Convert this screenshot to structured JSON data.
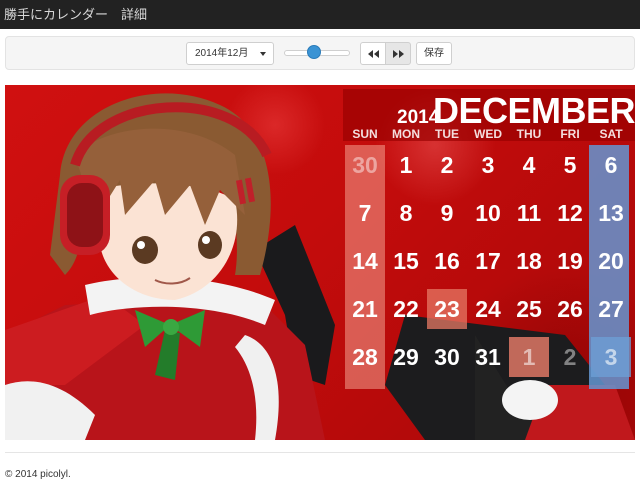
{
  "app": {
    "title": "勝手にカレンダー　詳細"
  },
  "toolbar": {
    "month_selected": "2014年12月",
    "slider_value": 0.45,
    "prev_label": "previous",
    "next_label": "next",
    "save_label": "保存"
  },
  "calendar": {
    "year": "2014",
    "month_name": "DECEMBER",
    "weekdays": [
      "SUN",
      "MON",
      "TUE",
      "WED",
      "THU",
      "FRI",
      "SAT"
    ],
    "weeks": [
      [
        "30",
        "1",
        "2",
        "3",
        "4",
        "5",
        "6"
      ],
      [
        "7",
        "8",
        "9",
        "10",
        "11",
        "12",
        "13"
      ],
      [
        "14",
        "15",
        "16",
        "17",
        "18",
        "19",
        "20"
      ],
      [
        "21",
        "22",
        "23",
        "24",
        "25",
        "26",
        "27"
      ],
      [
        "28",
        "29",
        "30",
        "31",
        "1",
        "2",
        "3"
      ]
    ],
    "highlighted_day": "23",
    "sunday_color": "#f3a999",
    "saturday_color": "#6f9fd2",
    "today_color": "#e97a66",
    "background_color": "#c80c0c"
  },
  "footer": {
    "copyright": "© 2014 picolyl."
  }
}
